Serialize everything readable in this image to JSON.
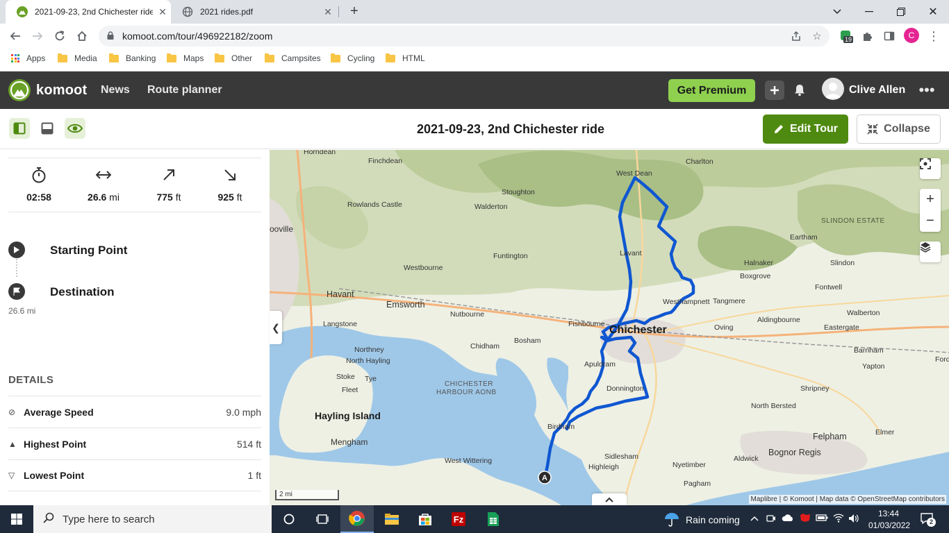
{
  "browser": {
    "tabs": [
      {
        "title": "2021-09-23, 2nd Chichester ride",
        "active": true
      },
      {
        "title": "2021 rides.pdf",
        "active": false
      }
    ],
    "url": "komoot.com/tour/496922182/zoom",
    "extension_badge": "19",
    "profile_initial": "C",
    "bookmarks": [
      "Apps",
      "Media",
      "Banking",
      "Maps",
      "Other",
      "Campsites",
      "Cycling",
      "HTML"
    ]
  },
  "header": {
    "logo": "komoot",
    "nav": [
      "News",
      "Route planner"
    ],
    "premium_label": "Get Premium",
    "user_name": "Clive Allen"
  },
  "subheader": {
    "title": "2021-09-23, 2nd Chichester ride",
    "edit_label": "Edit Tour",
    "collapse_label": "Collapse"
  },
  "stats": {
    "duration": "02:58",
    "distance_value": "26.6",
    "distance_unit": "mi",
    "uphill_value": "775",
    "uphill_unit": "ft",
    "downhill_value": "925",
    "downhill_unit": "ft"
  },
  "waypoints": {
    "start_label": "Starting Point",
    "destination_label": "Destination",
    "destination_distance": "26.6 mi"
  },
  "details": {
    "title": "DETAILS",
    "rows": [
      {
        "label": "Average Speed",
        "value": "9.0 mph",
        "icon": "speed-icon"
      },
      {
        "label": "Highest Point",
        "value": "514 ft",
        "icon": "triangle-up-icon"
      },
      {
        "label": "Lowest Point",
        "value": "1 ft",
        "icon": "triangle-down-icon"
      }
    ]
  },
  "map": {
    "places": {
      "horndean": "Horndean",
      "finchdean": "Finchdean",
      "west_dean": "West Dean",
      "charlton": "Charlton",
      "stoughton": "Stoughton",
      "rowlands_castle": "Rowlands Castle",
      "walderton": "Walderton",
      "slindon_estate": "SLINDON ESTATE",
      "waterlooville": "ooville",
      "eartham": "Eartham",
      "lavant": "Lavant",
      "funtington": "Funtington",
      "halnaker": "Halnaker",
      "slindon": "Slindon",
      "westbourne": "Westbourne",
      "boxgrove": "Boxgrove",
      "fontwell": "Fontwell",
      "havant": "Havant",
      "emsworth": "Emsworth",
      "westhampnett": "Westhampnett",
      "tangmere": "Tangmere",
      "nutbourne": "Nutbourne",
      "walberton": "Walberton",
      "langstone": "Langstone",
      "fishbourne": "Fishbourne",
      "chichester": "Chichester",
      "aldingbourne": "Aldingbourne",
      "oving": "Oving",
      "eastergate": "Eastergate",
      "chidham": "Chidham",
      "bosham": "Bosham",
      "northney": "Northney",
      "barnham": "Barnham",
      "north_hayling": "North Hayling",
      "apuldram": "Apuldram",
      "yapton": "Yapton",
      "ford": "Ford",
      "stoke": "Stoke",
      "tye": "Tye",
      "aonb_1": "CHICHESTER",
      "aonb_2": "HARBOUR AONB",
      "donnington": "Donnington",
      "shripney": "Shripney",
      "fleet": "Fleet",
      "north_bersted": "North Bersted",
      "hayling_island": "Hayling Island",
      "birdham": "Birdham",
      "felpham": "Felpham",
      "elmer": "Elmer",
      "mengham": "Mengham",
      "sidlesham": "Sidlesham",
      "bognor_regis": "Bognor Regis",
      "west_wittering": "West Wittering",
      "highleigh": "Highleigh",
      "aldwick": "Aldwick",
      "nyetimber": "Nyetimber",
      "pagham": "Pagham"
    },
    "start_marker": "A",
    "scale_label": "2 mi",
    "attribution": "Maplibre | © Komoot | Map data © OpenStreetMap contributors",
    "route_color": "#0f57d1"
  },
  "taskbar": {
    "search_placeholder": "Type here to search",
    "weather": "Rain coming",
    "time": "13:44",
    "date": "01/03/2022",
    "notification_count": "2"
  }
}
